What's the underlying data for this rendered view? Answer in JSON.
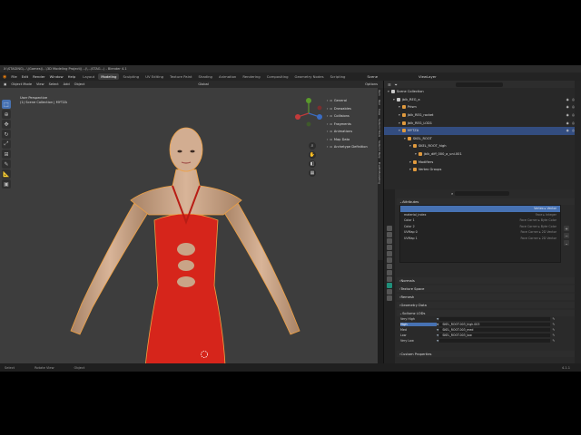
{
  "window": {
    "title": "X:\\STAGING\\...\\(Games)\\...\\3D Modeling Project\\(...)\\...\\STAG...) - Blender 4.1"
  },
  "menubar": {
    "items": [
      "File",
      "Edit",
      "Render",
      "Window",
      "Help"
    ],
    "workspaces": [
      "Layout",
      "Modeling",
      "Sculpting",
      "UV Editing",
      "Texture Paint",
      "Shading",
      "Animation",
      "Rendering",
      "Compositing",
      "Geometry Nodes",
      "Scripting"
    ],
    "active_workspace": "Modeling",
    "scene_label": "Scene",
    "viewlayer_label": "ViewLayer"
  },
  "viewport_header": {
    "mode": "Object Mode",
    "menus": [
      "View",
      "Select",
      "Add",
      "Object"
    ],
    "orientation": "Global",
    "options_label": "Options"
  },
  "viewport": {
    "view_name": "User Perspective",
    "collection_info": "(1) Scene Collection | MYTZA",
    "npanel_items": [
      "General",
      "Drawables",
      "Collisions",
      "Fragments",
      "Animations",
      "Map Data",
      "Archetype Definition"
    ]
  },
  "sidebar_tabs": [
    "Item",
    "Tool",
    "View",
    "Sollumz Tools",
    "Sollumz Help",
    "FiveM Modelling"
  ],
  "outliner": {
    "search_placeholder": "",
    "rows": [
      {
        "label": "Scene Collection",
        "depth": 0,
        "selected": false
      },
      {
        "label": "jblk_REG_a",
        "depth": 1,
        "selected": false
      },
      {
        "label": "Prism",
        "depth": 2,
        "selected": false
      },
      {
        "label": "jblk_REG_rocket",
        "depth": 2,
        "selected": false
      },
      {
        "label": "jblk_REG_LOD1",
        "depth": 2,
        "selected": false
      },
      {
        "label": "MYTZA",
        "depth": 2,
        "selected": true
      },
      {
        "label": "SKEL_ROOT",
        "depth": 3,
        "selected": false
      },
      {
        "label": "SKEL_ROOT_high",
        "depth": 4,
        "selected": false
      },
      {
        "label": "jblk_diff_000_a_uni.001",
        "depth": 5,
        "selected": false
      },
      {
        "label": "Modifiers",
        "depth": 4,
        "selected": false
      },
      {
        "label": "Vertex Groups",
        "depth": 4,
        "selected": false
      }
    ]
  },
  "properties": {
    "attributes_title": "Attributes",
    "attributes": [
      {
        "name": "",
        "meta": "Vertex ▸ Vector",
        "selected": true
      },
      {
        "name": "material_index",
        "meta": "Face ▸ Integer",
        "selected": false
      },
      {
        "name": "Color 1",
        "meta": "Face Corner ▸ Byte Color",
        "selected": false
      },
      {
        "name": "Color 2",
        "meta": "Face Corner ▸ Byte Color",
        "selected": false
      },
      {
        "name": "UVMap 0",
        "meta": "Face Corner ▸ 2D Vector",
        "selected": false
      },
      {
        "name": "UVMap 1",
        "meta": "Face Corner ▸ 2D Vector",
        "selected": false
      }
    ],
    "sections": [
      "Normals",
      "Texture Space",
      "Remesh",
      "Geometry Data"
    ],
    "lods_title": "Sollumz LODs",
    "lods": [
      {
        "level": "Very High",
        "mesh": "",
        "selected": false
      },
      {
        "level": "High",
        "mesh": "SKEL_ROOT.003_high.003",
        "selected": true
      },
      {
        "level": "Med",
        "mesh": "SKEL_ROOT.003_med",
        "selected": false
      },
      {
        "level": "Low",
        "mesh": "SKEL_ROOT.003_low",
        "selected": false
      },
      {
        "level": "Very Low",
        "mesh": "",
        "selected": false
      }
    ],
    "custom_props_title": "Custom Properties"
  },
  "statusbar": {
    "items": [
      "Select",
      "Rotate View",
      "Object"
    ],
    "version": "4.1.1"
  },
  "colors": {
    "selection": "#4772b3",
    "dress": "#d6251b",
    "skin": "#c9a487",
    "viewport_bg": "#3d3d3d"
  }
}
